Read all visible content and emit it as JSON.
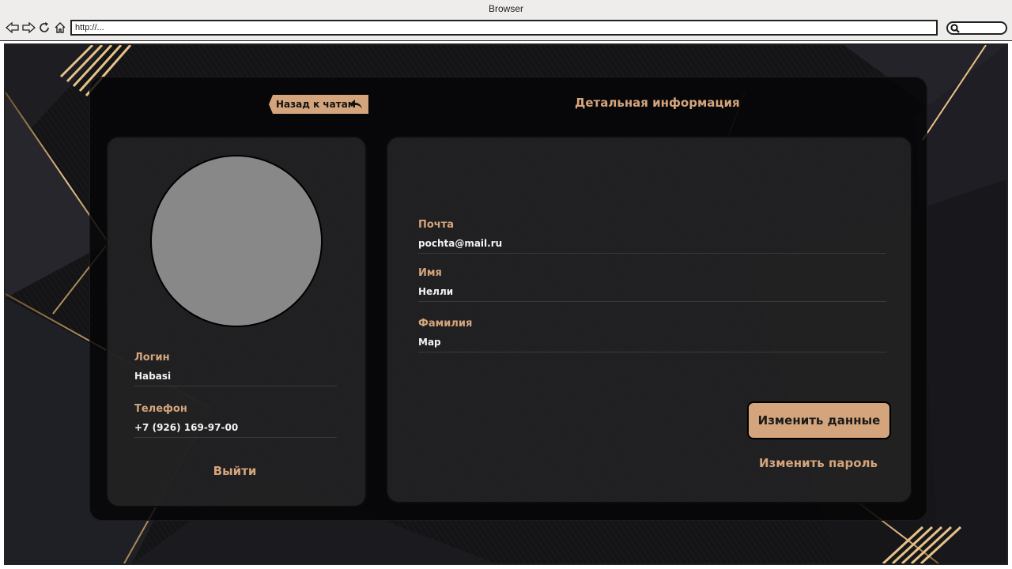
{
  "browser": {
    "window_title": "Browser",
    "address": "http://..."
  },
  "icons": {
    "back": "back-arrow-icon",
    "forward": "forward-arrow-icon",
    "reload": "reload-icon",
    "home": "home-icon",
    "search": "search-icon",
    "back_to_chats": "reply-arrow-icon"
  },
  "header": {
    "back_label": "Назад к чатам",
    "title": "Детальная информация"
  },
  "profile": {
    "login_label": "Логин",
    "login_value": "Habasi",
    "phone_label": "Телефон",
    "phone_value": "+7 (926) 169-97-00",
    "logout_label": "Выйти"
  },
  "details": {
    "email_label": "Почта",
    "email_value": "pochta@mail.ru",
    "name_label": "Имя",
    "name_value": "Нелли",
    "surname_label": "Фамилия",
    "surname_value": "Мар",
    "edit_button": "Изменить данные",
    "change_password": "Изменить пароль"
  },
  "colors": {
    "accent": "#d4a57c",
    "background": "#0d0d10",
    "card": "#242426",
    "avatar": "#888888"
  }
}
